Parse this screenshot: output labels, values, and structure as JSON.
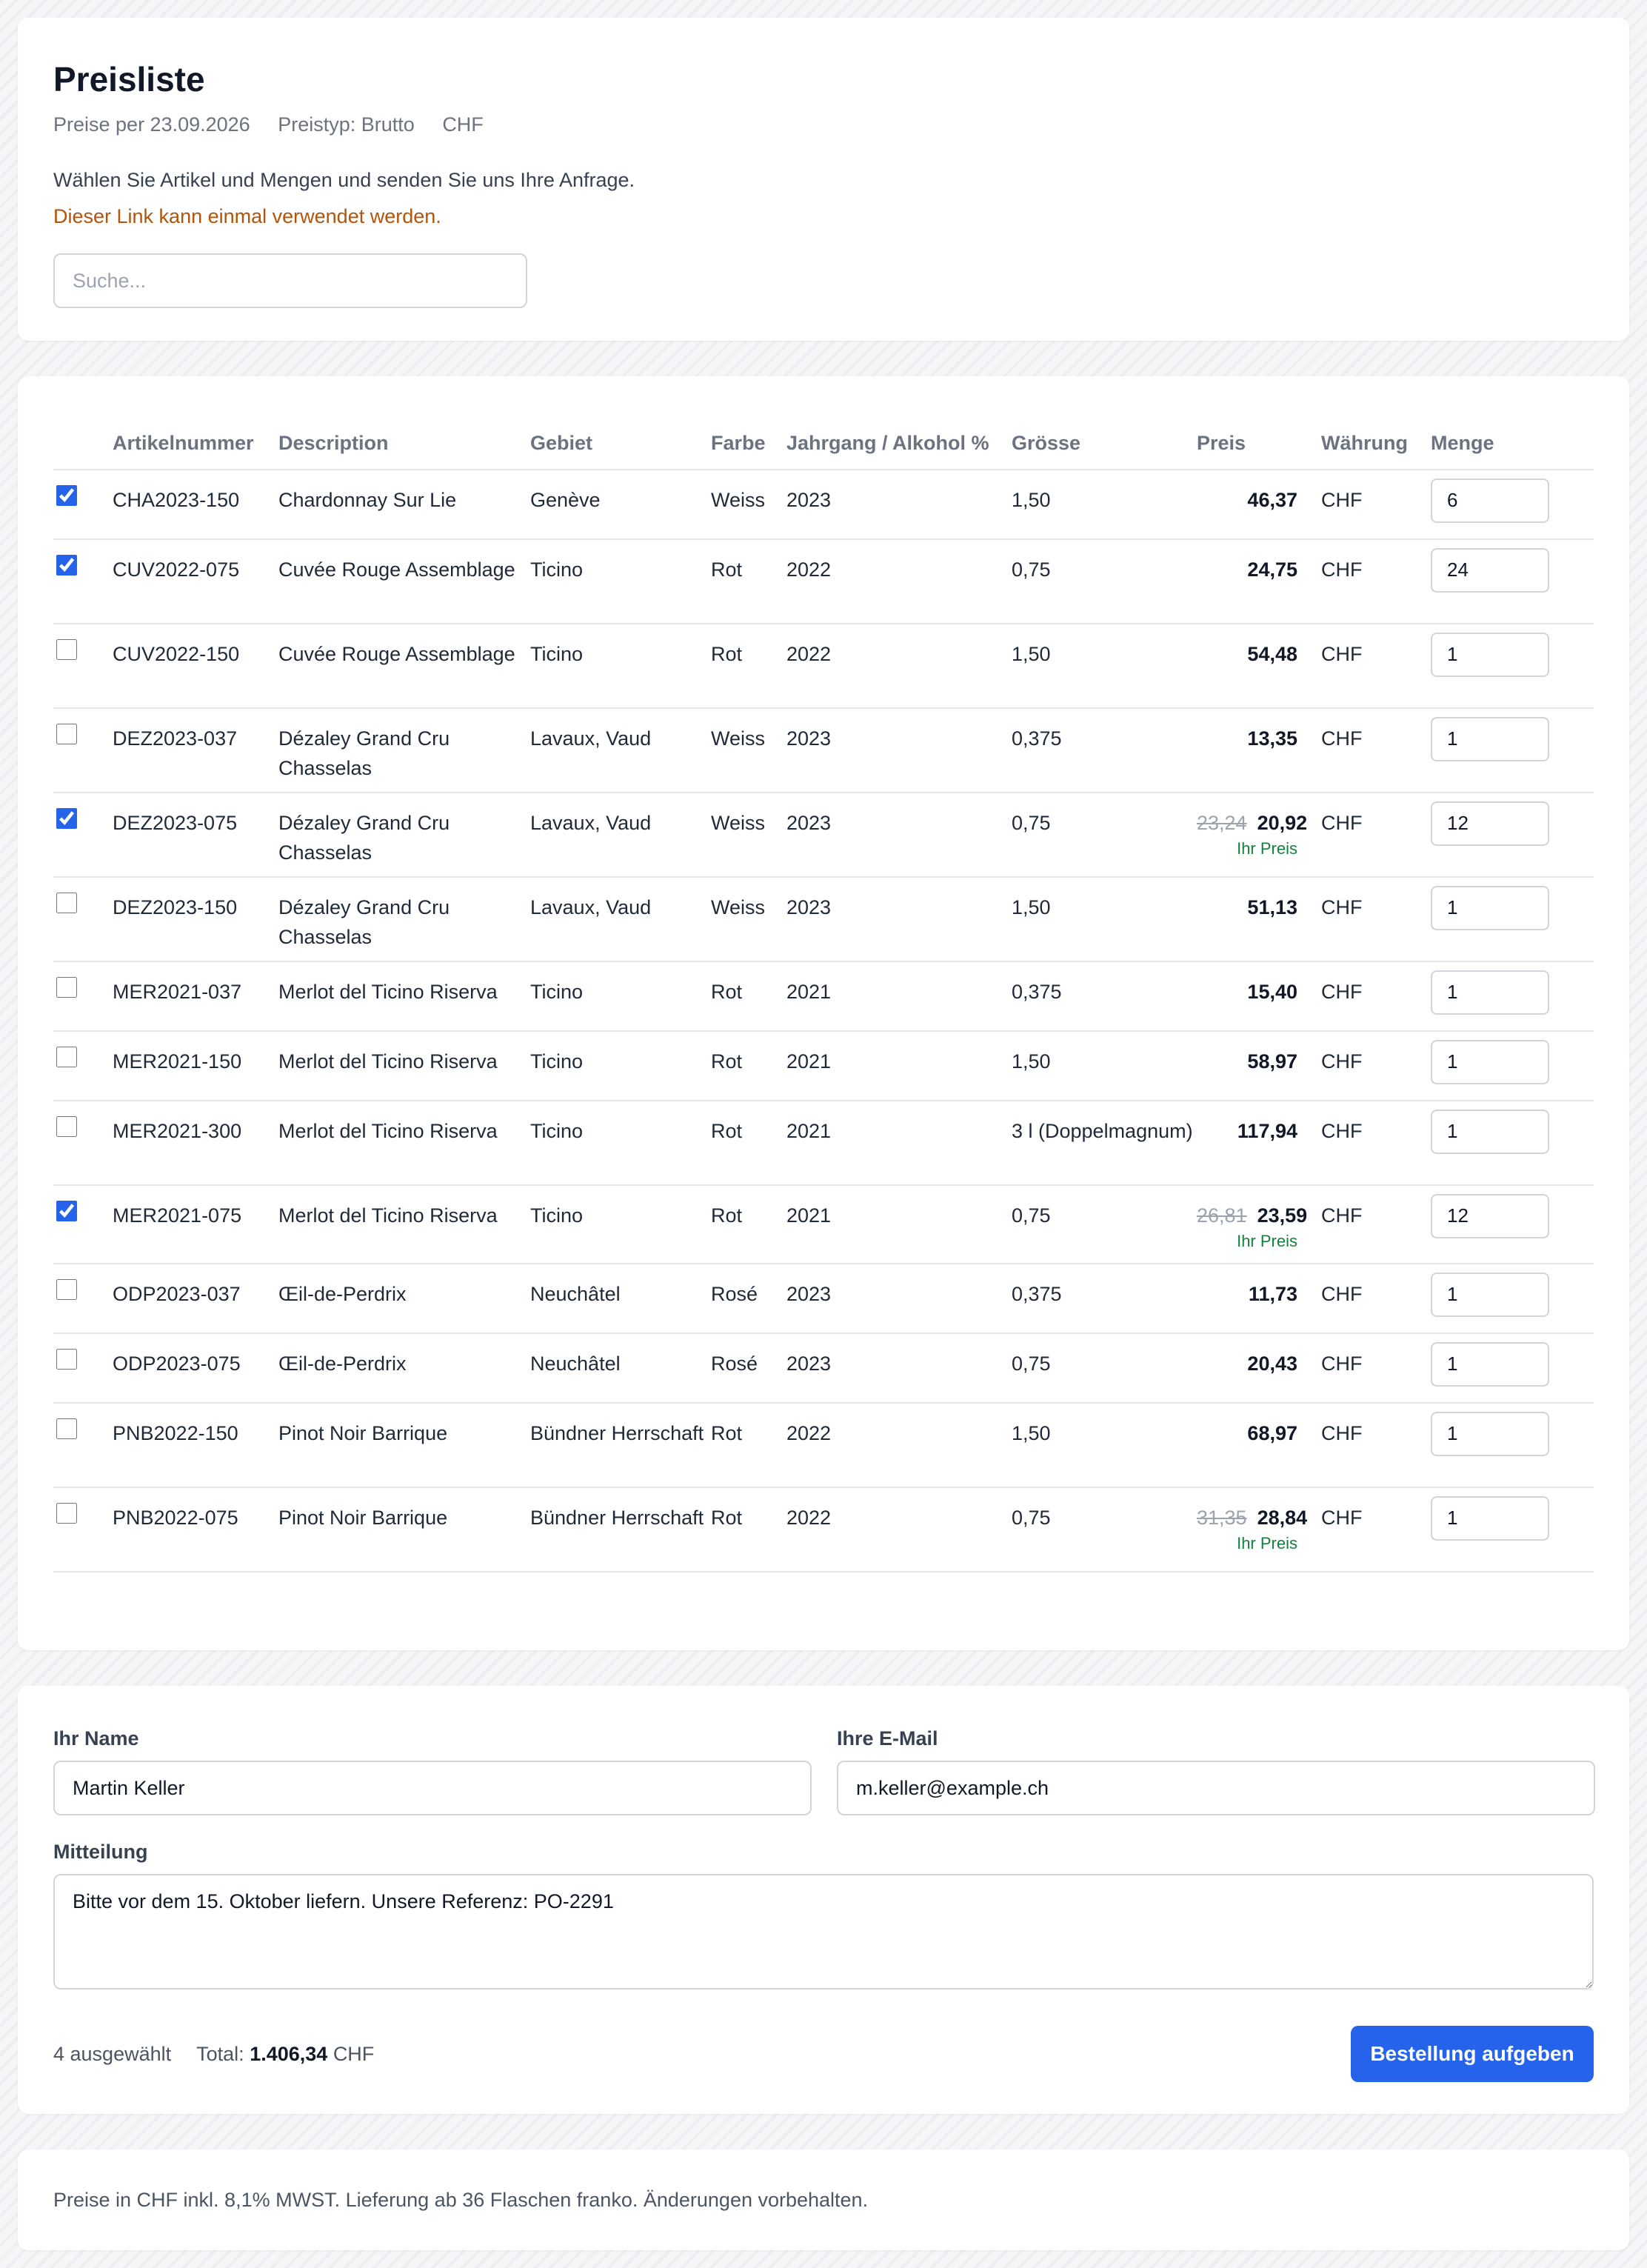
{
  "header": {
    "title": "Preisliste",
    "meta": [
      "Preise per 23.09.2026",
      "Preistyp: Brutto",
      "CHF"
    ],
    "intro": "Wählen Sie Artikel und Mengen und senden Sie uns Ihre Anfrage.",
    "warning": "Dieser Link kann einmal verwendet werden.",
    "search_placeholder": "Suche..."
  },
  "colors": {
    "accent": "#2563eb",
    "warning": "#b45309",
    "your_price": "#15803d"
  },
  "table": {
    "columns": [
      "Artikelnummer",
      "Description",
      "Gebiet",
      "Farbe",
      "Jahrgang / Alkohol %",
      "Grösse",
      "Preis",
      "Währung",
      "Menge"
    ],
    "rows": [
      {
        "checked": true,
        "art": "CHA2023-150",
        "desc": "Chardonnay Sur Lie",
        "gebiet": "Genève",
        "farbe": "Weiss",
        "jahr": "2023",
        "groesse": "1,50",
        "old_price": "",
        "price": "46,37",
        "your_price": "",
        "currency": "CHF",
        "qty": "6"
      },
      {
        "checked": true,
        "art": "CUV2022-075",
        "desc": "Cuvée Rouge Assemblage",
        "gebiet": "Ticino",
        "farbe": "Rot",
        "jahr": "2022",
        "groesse": "0,75",
        "old_price": "",
        "price": "24,75",
        "your_price": "",
        "currency": "CHF",
        "qty": "24"
      },
      {
        "checked": false,
        "art": "CUV2022-150",
        "desc": "Cuvée Rouge Assemblage",
        "gebiet": "Ticino",
        "farbe": "Rot",
        "jahr": "2022",
        "groesse": "1,50",
        "old_price": "",
        "price": "54,48",
        "your_price": "",
        "currency": "CHF",
        "qty": "1"
      },
      {
        "checked": false,
        "art": "DEZ2023-037",
        "desc": "Dézaley Grand Cru Chasselas",
        "gebiet": "Lavaux, Vaud",
        "farbe": "Weiss",
        "jahr": "2023",
        "groesse": "0,375",
        "old_price": "",
        "price": "13,35",
        "your_price": "",
        "currency": "CHF",
        "qty": "1"
      },
      {
        "checked": true,
        "art": "DEZ2023-075",
        "desc": "Dézaley Grand Cru Chasselas",
        "gebiet": "Lavaux, Vaud",
        "farbe": "Weiss",
        "jahr": "2023",
        "groesse": "0,75",
        "old_price": "23,24",
        "price": "20,92",
        "your_price": "Ihr Preis",
        "currency": "CHF",
        "qty": "12"
      },
      {
        "checked": false,
        "art": "DEZ2023-150",
        "desc": "Dézaley Grand Cru Chasselas",
        "gebiet": "Lavaux, Vaud",
        "farbe": "Weiss",
        "jahr": "2023",
        "groesse": "1,50",
        "old_price": "",
        "price": "51,13",
        "your_price": "",
        "currency": "CHF",
        "qty": "1"
      },
      {
        "checked": false,
        "art": "MER2021-037",
        "desc": "Merlot del Ticino Riserva",
        "gebiet": "Ticino",
        "farbe": "Rot",
        "jahr": "2021",
        "groesse": "0,375",
        "old_price": "",
        "price": "15,40",
        "your_price": "",
        "currency": "CHF",
        "qty": "1"
      },
      {
        "checked": false,
        "art": "MER2021-150",
        "desc": "Merlot del Ticino Riserva",
        "gebiet": "Ticino",
        "farbe": "Rot",
        "jahr": "2021",
        "groesse": "1,50",
        "old_price": "",
        "price": "58,97",
        "your_price": "",
        "currency": "CHF",
        "qty": "1"
      },
      {
        "checked": false,
        "art": "MER2021-300",
        "desc": "Merlot del Ticino Riserva",
        "gebiet": "Ticino",
        "farbe": "Rot",
        "jahr": "2021",
        "groesse": "3 l (Doppelmagnum)",
        "old_price": "",
        "price": "117,94",
        "your_price": "",
        "currency": "CHF",
        "qty": "1"
      },
      {
        "checked": true,
        "art": "MER2021-075",
        "desc": "Merlot del Ticino Riserva",
        "gebiet": "Ticino",
        "farbe": "Rot",
        "jahr": "2021",
        "groesse": "0,75",
        "old_price": "26,81",
        "price": "23,59",
        "your_price": "Ihr Preis",
        "currency": "CHF",
        "qty": "12"
      },
      {
        "checked": false,
        "art": "ODP2023-037",
        "desc": "Œil-de-Perdrix",
        "gebiet": "Neuchâtel",
        "farbe": "Rosé",
        "jahr": "2023",
        "groesse": "0,375",
        "old_price": "",
        "price": "11,73",
        "your_price": "",
        "currency": "CHF",
        "qty": "1"
      },
      {
        "checked": false,
        "art": "ODP2023-075",
        "desc": "Œil-de-Perdrix",
        "gebiet": "Neuchâtel",
        "farbe": "Rosé",
        "jahr": "2023",
        "groesse": "0,75",
        "old_price": "",
        "price": "20,43",
        "your_price": "",
        "currency": "CHF",
        "qty": "1"
      },
      {
        "checked": false,
        "art": "PNB2022-150",
        "desc": "Pinot Noir Barrique",
        "gebiet": "Bündner Herrschaft",
        "farbe": "Rot",
        "jahr": "2022",
        "groesse": "1,50",
        "old_price": "",
        "price": "68,97",
        "your_price": "",
        "currency": "CHF",
        "qty": "1"
      },
      {
        "checked": false,
        "art": "PNB2022-075",
        "desc": "Pinot Noir Barrique",
        "gebiet": "Bündner Herrschaft",
        "farbe": "Rot",
        "jahr": "2022",
        "groesse": "0,75",
        "old_price": "31,35",
        "price": "28,84",
        "your_price": "Ihr Preis",
        "currency": "CHF",
        "qty": "1"
      }
    ]
  },
  "form": {
    "name_label": "Ihr Name",
    "name_value": "Martin Keller",
    "email_label": "Ihre E-Mail",
    "email_value": "m.keller@example.ch",
    "message_label": "Mitteilung",
    "message_value": "Bitte vor dem 15. Oktober liefern. Unsere Referenz: PO-2291",
    "selected_count": "4 ausgewählt",
    "total_label": "Total:",
    "total_value": "1.406,34",
    "total_currency": "CHF",
    "submit_label": "Bestellung aufgeben"
  },
  "footer": {
    "text": "Preise in CHF inkl. 8,1% MWST. Lieferung ab 36 Flaschen franko. Änderungen vorbehalten."
  }
}
